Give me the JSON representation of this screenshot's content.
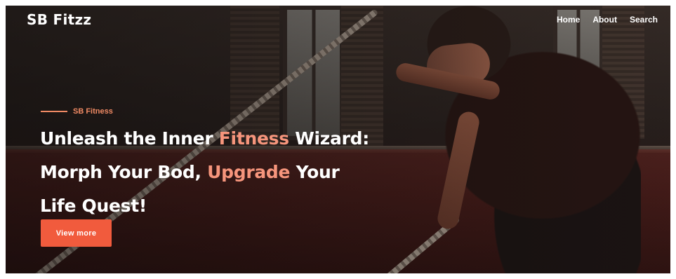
{
  "brand": {
    "logo_text": "SB Fitzz"
  },
  "nav": {
    "items": [
      "Home",
      "About",
      "Search"
    ]
  },
  "hero": {
    "eyebrow": "SB Fitness",
    "headline": {
      "part1": "Unleash the Inner ",
      "accent1": "Fitness",
      "part2": " Wizard:",
      "part3": "Morph Your Bod, ",
      "accent2": "Upgrade",
      "part4": " Your",
      "part5": "Life Quest!"
    },
    "cta_label": "View more"
  },
  "colors": {
    "accent": "#f15b3d",
    "accent_text": "#f6957c",
    "eyebrow": "#f08a64",
    "text": "#ffffff"
  }
}
